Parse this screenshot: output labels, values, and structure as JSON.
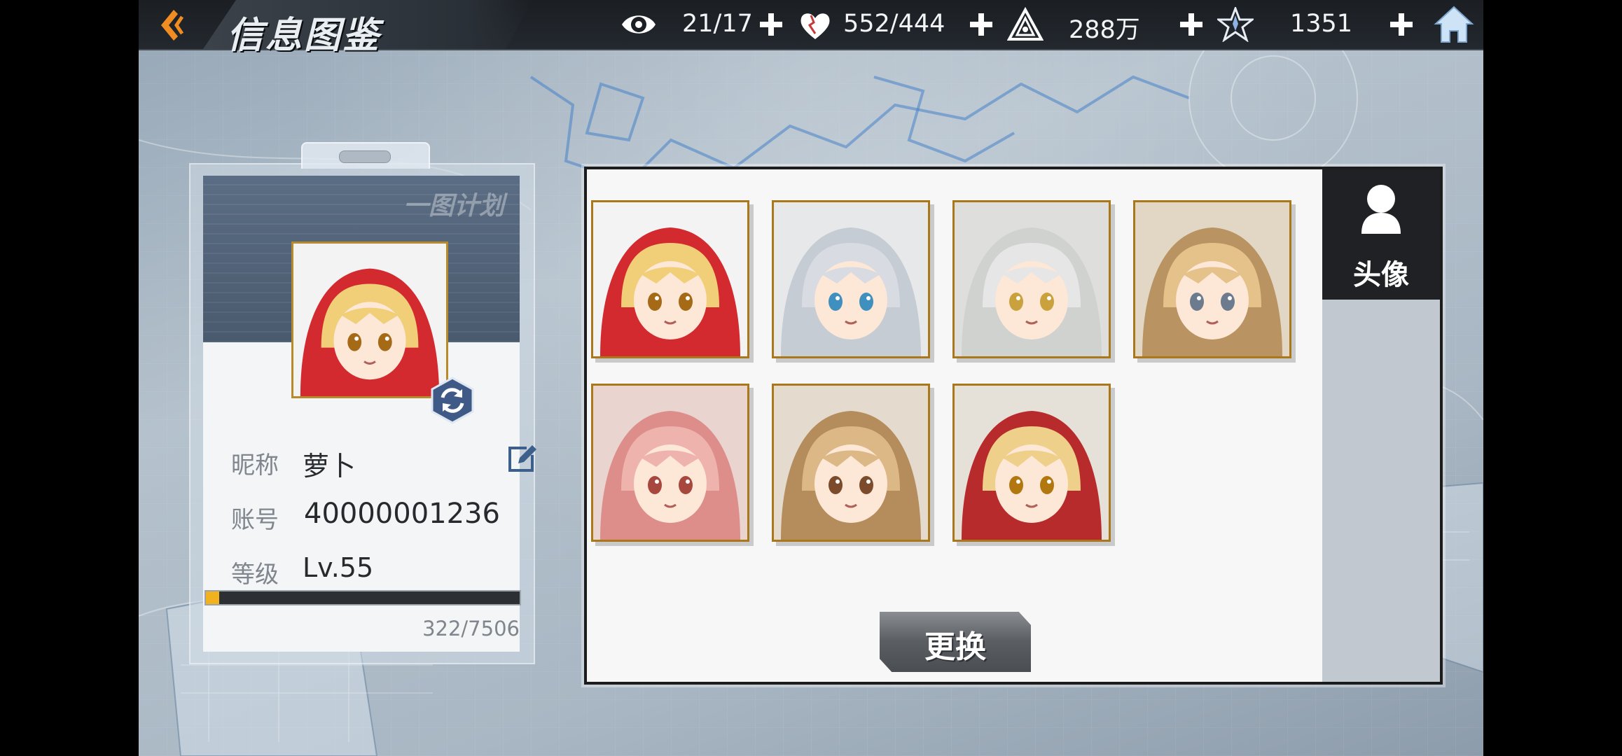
{
  "header": {
    "title": "信息图鉴",
    "resources": [
      {
        "icon": "eye-icon",
        "value": "21/17"
      },
      {
        "icon": "heart-icon",
        "value": "552/444"
      },
      {
        "icon": "triangle-emblem-icon",
        "value": "288万"
      },
      {
        "icon": "star-crystal-icon",
        "value": "1351"
      }
    ]
  },
  "profile": {
    "watermark": "一图计划",
    "nickname_label": "昵称",
    "nickname": "萝卜",
    "account_label": "账号",
    "account": "40000001236",
    "level_label": "等级",
    "level": "Lv.55",
    "exp_text": "322/7506",
    "exp_progress": 0.043
  },
  "avatar_panel": {
    "tab_label": "头像",
    "change_button": "更换",
    "avatars": [
      {
        "hair": "#f1cf78",
        "hood": "#d22a2f",
        "eyes": "#a56a16",
        "bg": "#f3f3f3"
      },
      {
        "hair": "#d8dce2",
        "hood": "#c6ccd4",
        "eyes": "#3f8fbf",
        "bg": "#e7e8ea"
      },
      {
        "hair": "#e6e6e6",
        "hood": "#cfd2cf",
        "eyes": "#c9a23d",
        "bg": "#dedfdc"
      },
      {
        "hair": "#e5c28a",
        "hood": "#b99362",
        "eyes": "#6c7c8e",
        "bg": "#e2d7c4"
      },
      {
        "hair": "#efb3ad",
        "hood": "#dd8e8b",
        "eyes": "#a8473e",
        "bg": "#e9d4d0"
      },
      {
        "hair": "#ddb887",
        "hood": "#b58c5c",
        "eyes": "#7c4b2c",
        "bg": "#e4dbce"
      },
      {
        "hair": "#efd08b",
        "hood": "#b82b2c",
        "eyes": "#b2780f",
        "bg": "#e6e1d8"
      }
    ]
  },
  "colors": {
    "accent_gold": "#f2b21f",
    "tile_border": "#a9781d",
    "topbar": "#1b1f24"
  }
}
